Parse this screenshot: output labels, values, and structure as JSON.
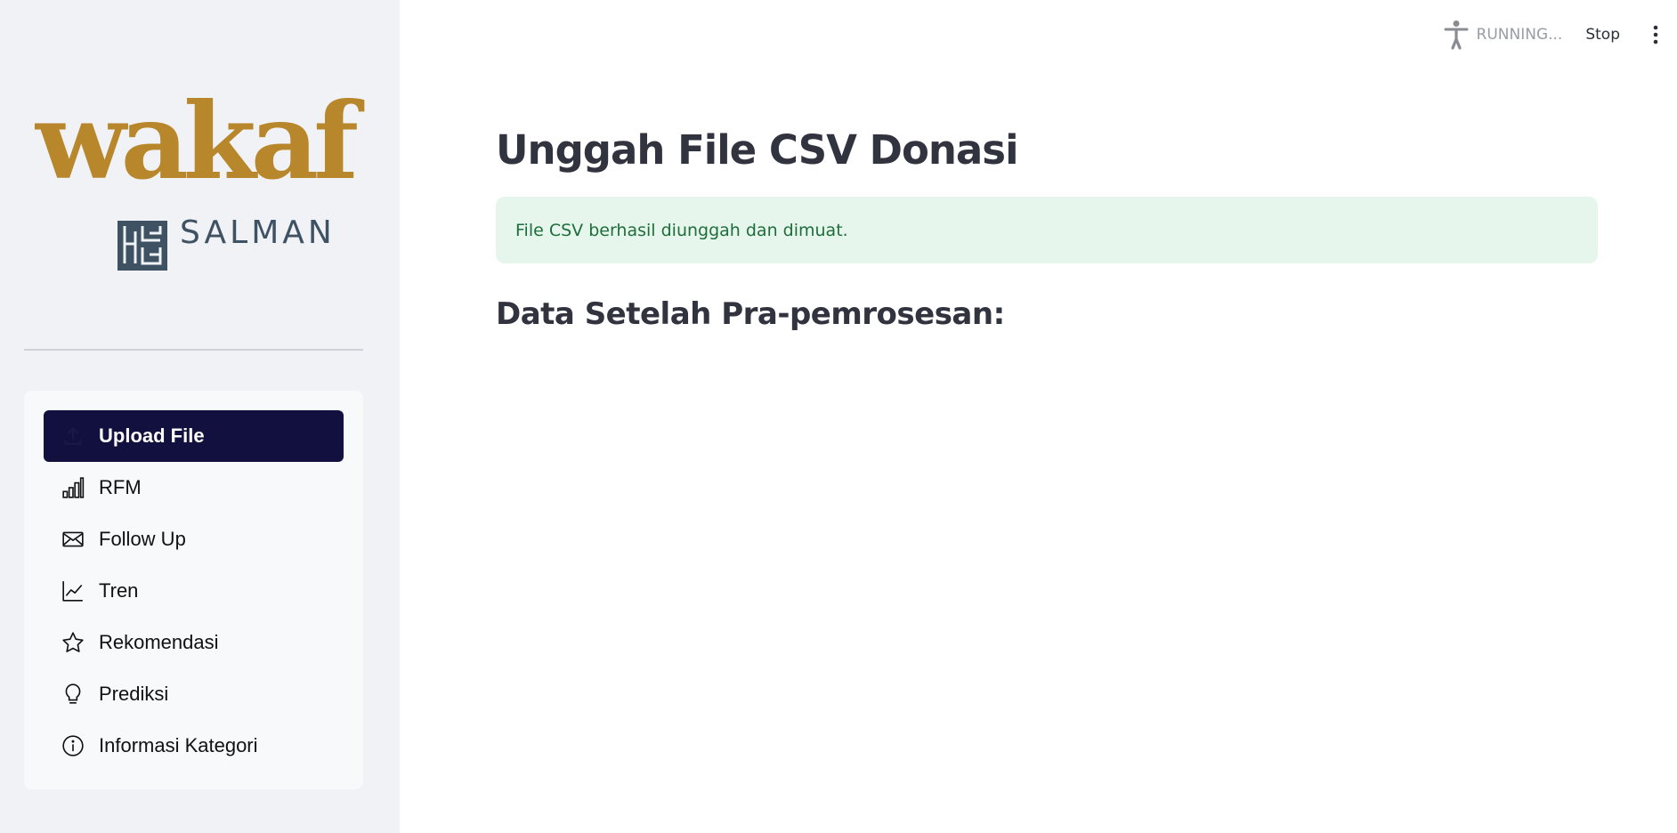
{
  "header": {
    "status": "RUNNING...",
    "stop_label": "Stop",
    "running_icon": "running-person-icon",
    "menu_icon": "kebab-menu-icon"
  },
  "sidebar": {
    "logo": {
      "word": "wakaf",
      "sub": "SALMAN",
      "word_color": "#b8862b",
      "sub_color": "#3e5264"
    },
    "nav": {
      "items": [
        {
          "label": "Upload File",
          "icon": "upload-icon",
          "active": true
        },
        {
          "label": "RFM",
          "icon": "bar-chart-icon",
          "active": false
        },
        {
          "label": "Follow Up",
          "icon": "envelope-icon",
          "active": false
        },
        {
          "label": "Tren",
          "icon": "line-chart-icon",
          "active": false
        },
        {
          "label": "Rekomendasi",
          "icon": "star-icon",
          "active": false
        },
        {
          "label": "Prediksi",
          "icon": "lightbulb-icon",
          "active": false
        },
        {
          "label": "Informasi Kategori",
          "icon": "info-icon",
          "active": false
        }
      ],
      "active_color": "#12103f"
    }
  },
  "main": {
    "title": "Unggah File CSV Donasi",
    "alert": {
      "text": "File CSV berhasil diunggah dan dimuat.",
      "bg_color": "#e6f6ec",
      "text_color": "#1e6e3b"
    },
    "subtitle": "Data Setelah Pra-pemrosesan:"
  }
}
